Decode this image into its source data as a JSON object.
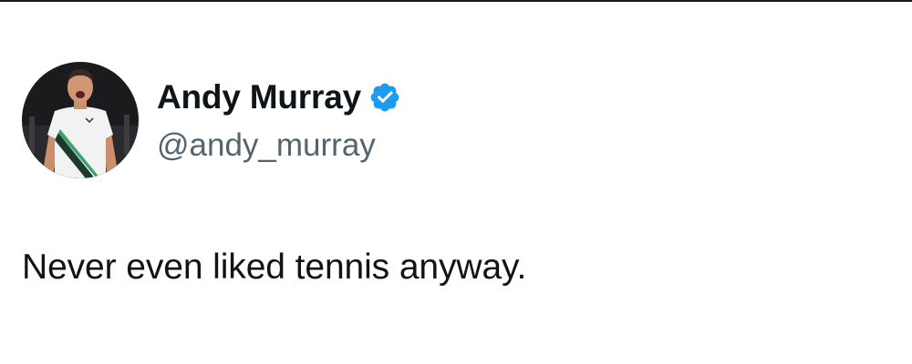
{
  "author": {
    "display_name": "Andy Murray",
    "handle": "@andy_murray",
    "verified": true,
    "avatar_icon": "profile-photo",
    "verified_icon": "verified-badge-icon"
  },
  "tweet": {
    "text": "Never even liked tennis anyway."
  },
  "colors": {
    "verified_badge": "#1d9bf0",
    "text_primary": "#0f1419",
    "text_secondary": "#536471",
    "top_border": "#1a1a1a"
  }
}
